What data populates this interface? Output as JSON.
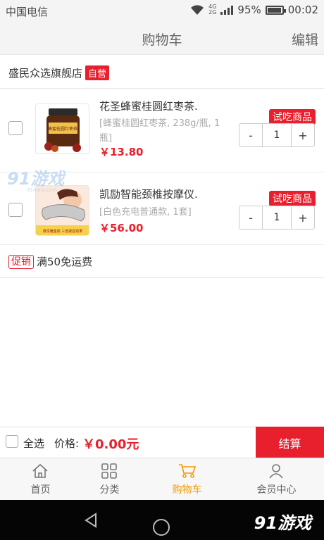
{
  "status_bar": {
    "carrier": "中国电信",
    "network_tags": [
      "4G",
      "2G"
    ],
    "battery_text": "95%",
    "battery_level": 0.95,
    "time": "00:02"
  },
  "title_bar": {
    "title": "购物车",
    "edit_label": "编辑"
  },
  "store": {
    "name": "盛民众选旗舰店",
    "tag": "自营"
  },
  "items": [
    {
      "name": "花圣蜂蜜桂圆红枣茶.",
      "spec": "[蜂蜜桂圆红枣茶, 238g/瓶, 1瓶]",
      "price": "￥13.80",
      "badge": "试吃商品",
      "quantity": "1",
      "minus": "-",
      "plus": "+",
      "thumb_text": "蜂蜜桂圆红枣茶"
    },
    {
      "name": "凯励智能颈椎按摩仪.",
      "spec": "[白色充电普通款, 1套]",
      "price": "￥56.00",
      "badge": "试吃商品",
      "quantity": "1",
      "minus": "-",
      "plus": "+",
      "thumb_text": "尊享镀金款 三倍揉捏效果"
    }
  ],
  "promo": {
    "badge": "促销",
    "text": "满50免运费"
  },
  "watermark": {
    "text": "91游戏",
    "subtext": "91danji.com"
  },
  "checkout": {
    "select_all": "全选",
    "price_label": "价格:",
    "total": "￥0.00元",
    "pay_label": "结算"
  },
  "tabs": [
    {
      "label": "首页",
      "icon": "home-icon"
    },
    {
      "label": "分类",
      "icon": "grid-icon"
    },
    {
      "label": "购物车",
      "icon": "cart-icon",
      "active": true
    },
    {
      "label": "会员中心",
      "icon": "user-icon"
    }
  ],
  "nav_bar": {
    "logo_text": "91游戏"
  },
  "colors": {
    "accent_red": "#e8202d",
    "active_tab": "#f39800"
  }
}
